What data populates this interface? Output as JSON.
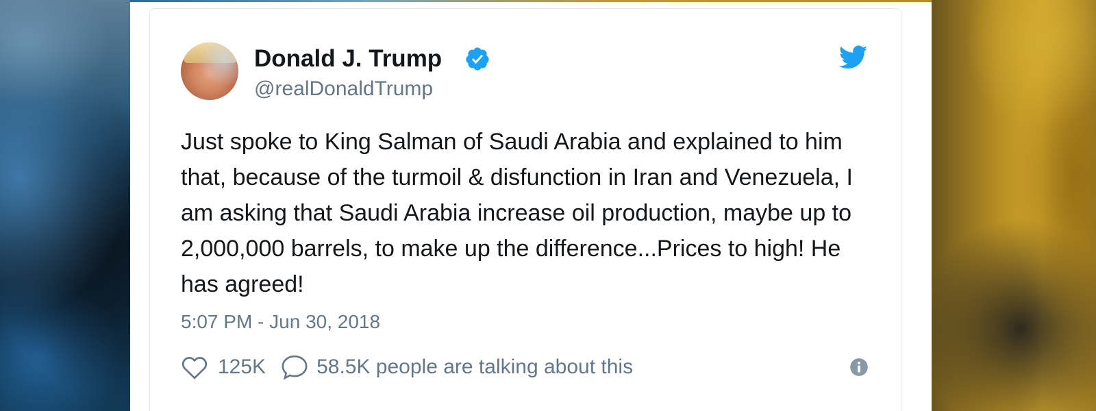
{
  "tweet": {
    "display_name": "Donald J. Trump",
    "handle": "@realDonaldTrump",
    "text": "Just spoke to King Salman of Saudi Arabia and explained to him that, because of the turmoil & disfunction in Iran and Venezuela, I am asking that Saudi Arabia increase oil production, maybe up to 2,000,000 barrels, to make up the difference...Prices to high! He has agreed!",
    "timestamp": "5:07 PM - Jun 30, 2018",
    "likes": "125K",
    "talking": "58.5K people are talking about this"
  },
  "icons": {
    "verified": "verified-badge-icon",
    "brand": "twitter-bird-icon",
    "like": "heart-icon",
    "reply": "speech-bubble-icon",
    "info": "info-icon"
  },
  "colors": {
    "twitter_blue": "#1da1f2",
    "text_primary": "#14171a",
    "text_secondary": "#657786"
  }
}
